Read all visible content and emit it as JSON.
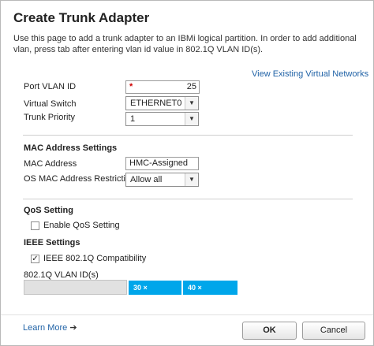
{
  "dialog": {
    "title": "Create Trunk Adapter",
    "description": "Use this page to add a trunk adapter to an IBMi logical partition. In order to add additional vlan, press tab after entering vlan id value in 802.1Q VLAN ID(s).",
    "view_link": "View Existing Virtual Networks"
  },
  "general": {
    "port_vlan_label": "Port VLAN ID",
    "port_vlan_required": "*",
    "port_vlan_value": "25",
    "virtual_switch_label": "Virtual Switch",
    "virtual_switch_value": "ETHERNET0",
    "trunk_priority_label": "Trunk Priority",
    "trunk_priority_value": "1"
  },
  "mac": {
    "heading": "MAC Address Settings",
    "address_label": "MAC Address",
    "address_value": "HMC-Assigned",
    "os_restrictions_label": "OS MAC Address Restrictions",
    "os_restrictions_value": "Allow all"
  },
  "qos": {
    "heading": "QoS Setting",
    "enable_label": "Enable QoS Setting",
    "enable_checked": false
  },
  "ieee": {
    "heading": "IEEE Settings",
    "compat_label": "IEEE 802.1Q Compatibility",
    "compat_checked": true,
    "vlan_ids_label": "802.1Q VLAN ID(s)",
    "vlan_tags": [
      "30 ×",
      "40 ×"
    ]
  },
  "footer": {
    "learn_more": "Learn More",
    "learn_more_arrow": "➔",
    "ok": "OK",
    "cancel": "Cancel"
  },
  "colors": {
    "tag": "#00a6ea",
    "link": "#2163a7",
    "required": "#d00000"
  }
}
